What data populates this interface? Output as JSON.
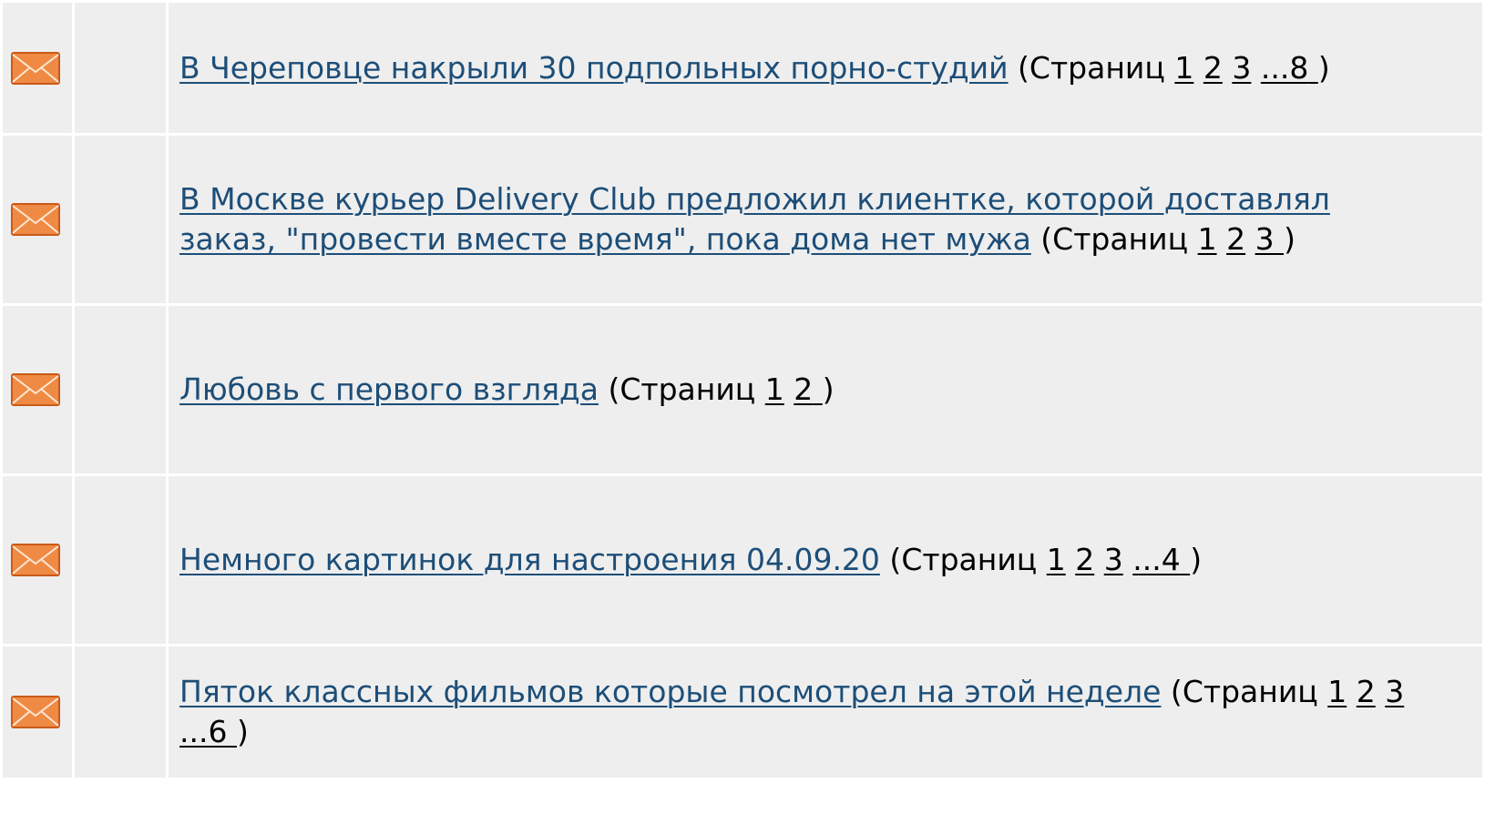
{
  "pages_word": "Страниц",
  "icon": "envelope-icon",
  "colors": {
    "row_bg": "#eeeeee",
    "link": "#1d4e78",
    "envelope_fill": "#ef8a44",
    "envelope_stroke": "#c85a18"
  },
  "topics": [
    {
      "title": "В Череповце накрыли 30 подпольных порно-студий",
      "open_paren": " (",
      "pages": [
        "1",
        "2",
        "3",
        "...8"
      ],
      "close_paren": ")"
    },
    {
      "title": "В Москве курьер Delivery Club предложил клиентке, которой доставлял заказ, \"провести вместе время\", пока дома нет мужа",
      "open_paren": " (",
      "pages": [
        "1",
        "2",
        "3"
      ],
      "close_paren": ")"
    },
    {
      "title": "Любовь с первого взгляда",
      "open_paren": " (",
      "pages": [
        "1",
        "2"
      ],
      "close_paren": ")"
    },
    {
      "title": "Немного картинок для настроения 04.09.20",
      "open_paren": " (",
      "pages": [
        "1",
        "2",
        "3",
        "...4"
      ],
      "close_paren": ")"
    },
    {
      "title": "Пяток классных фильмов которые посмотрел на этой неделе",
      "open_paren": " (",
      "pages": [
        "1",
        "2",
        "3",
        "...6"
      ],
      "close_paren": ")"
    }
  ]
}
